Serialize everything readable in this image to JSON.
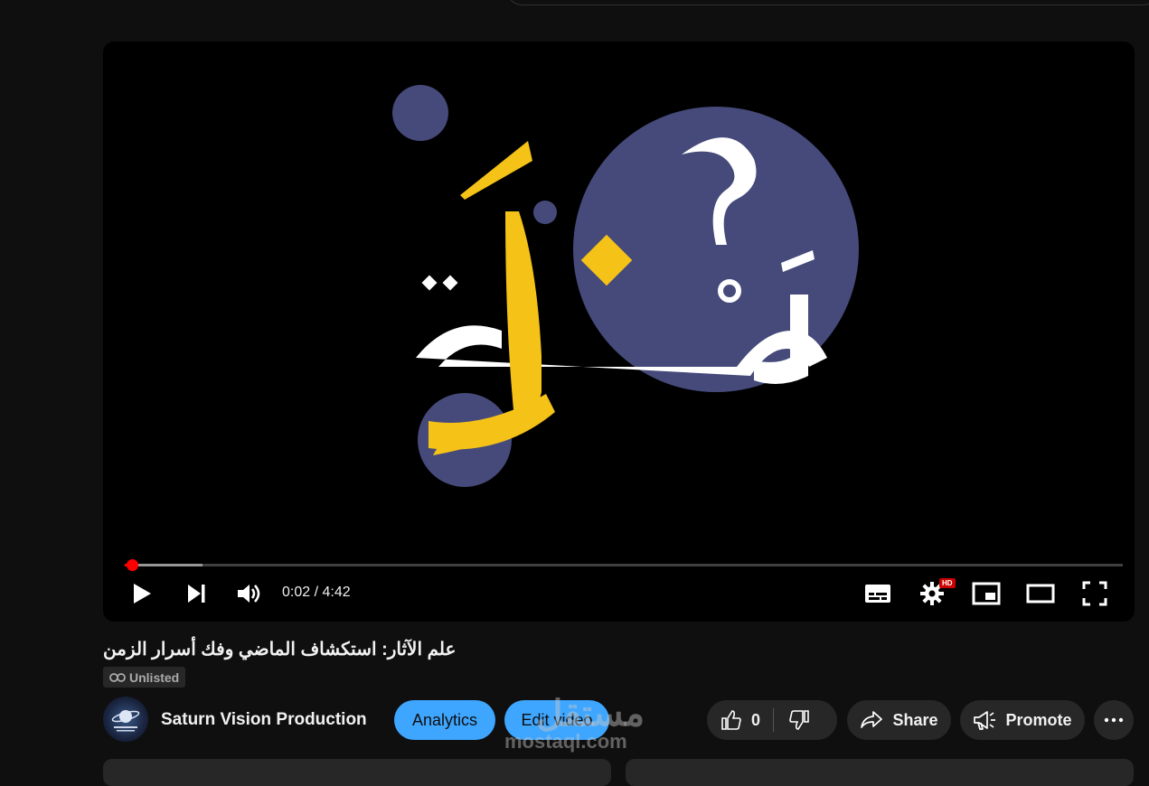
{
  "player": {
    "time_current": "0:02",
    "time_total": "4:42",
    "time_display": "0:02 / 4:42",
    "progress_fraction": 0.007,
    "buffered_fraction": 0.078,
    "hd_label": "HD",
    "thumbnail_text": "لَحْظَة ؟"
  },
  "video": {
    "title": "علم الآثار: استكشاف الماضي وفك أسرار الزمن",
    "visibility": "Unlisted"
  },
  "channel": {
    "name": "Saturn Vision Production"
  },
  "actions": {
    "analytics_label": "Analytics",
    "edit_label": "Edit video",
    "like_count": "0",
    "share_label": "Share",
    "promote_label": "Promote"
  },
  "watermark": {
    "arabic": "مستقل",
    "latin": "mostaql.com"
  },
  "colors": {
    "accent_blue": "#3ea6ff",
    "progress_red": "#ff0000",
    "thumb_circle": "#454a7a",
    "thumb_yellow": "#f5c217"
  },
  "icons": [
    "play-icon",
    "next-icon",
    "volume-icon",
    "subtitles-icon",
    "settings-icon",
    "miniplayer-icon",
    "theater-icon",
    "fullscreen-icon",
    "link-icon",
    "like-icon",
    "dislike-icon",
    "share-icon",
    "promote-icon",
    "more-icon"
  ]
}
